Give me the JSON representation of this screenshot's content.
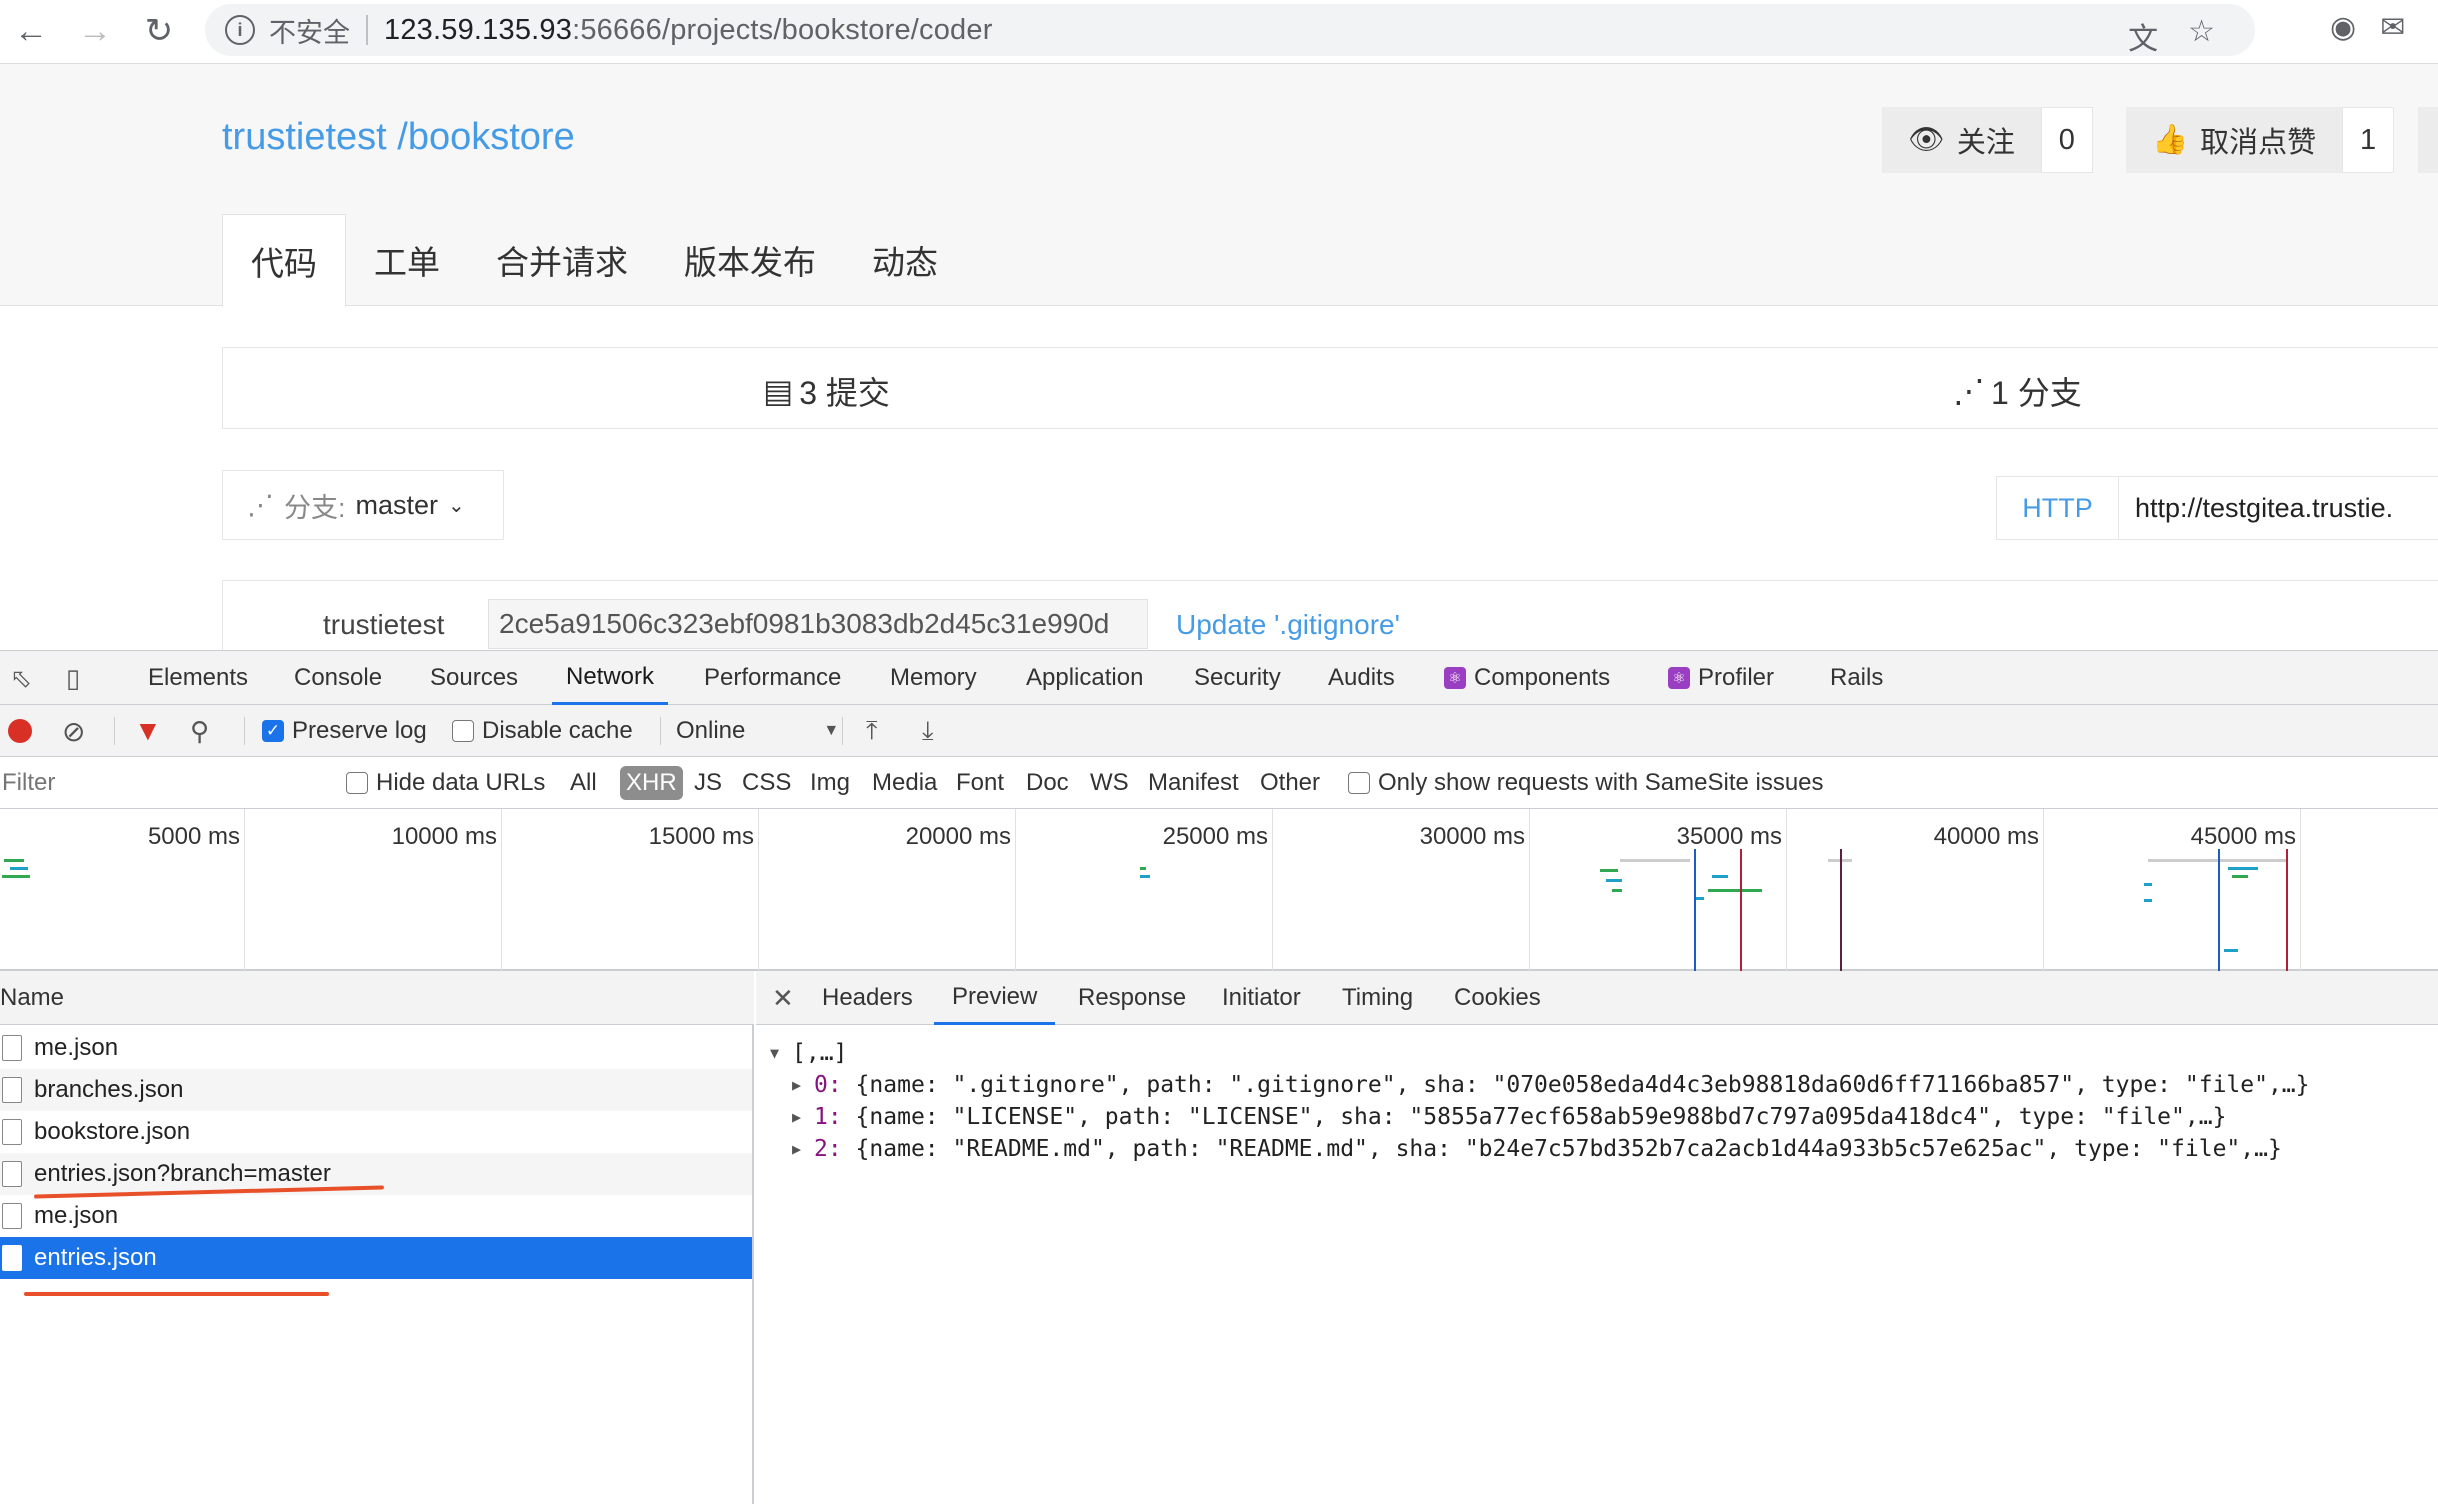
{
  "browser": {
    "insecure_label": "不安全",
    "url_host": "123.59.135.93",
    "url_rest": ":56666/projects/bookstore/coder"
  },
  "repo": {
    "title": "trustietest /bookstore",
    "watch_label": "关注",
    "watch_count": "0",
    "like_label": "取消点赞",
    "like_count": "1",
    "tabs": [
      "代码",
      "工单",
      "合并请求",
      "版本发布",
      "动态"
    ],
    "commits_stat": "3 提交",
    "branches_stat": "1 分支",
    "branch_label": "分支:",
    "branch_value": "master",
    "clone_protocol": "HTTP",
    "clone_url": "http://testgitea.trustie.",
    "commit_author": "trustietest",
    "commit_sha": "2ce5a91506c323ebf0981b3083db2d45c31e990d",
    "commit_message": "Update '.gitignore'"
  },
  "devtools": {
    "tabs": [
      "Elements",
      "Console",
      "Sources",
      "Network",
      "Performance",
      "Memory",
      "Application",
      "Security",
      "Audits",
      "Components",
      "Profiler",
      "Rails"
    ],
    "toolbar": {
      "preserve_log": "Preserve log",
      "disable_cache": "Disable cache",
      "throttle": "Online"
    },
    "filter": {
      "placeholder": "Filter",
      "hide_data_urls": "Hide data URLs",
      "types": [
        "All",
        "XHR",
        "JS",
        "CSS",
        "Img",
        "Media",
        "Font",
        "Doc",
        "WS",
        "Manifest",
        "Other"
      ],
      "samesite": "Only show requests with SameSite issues"
    },
    "timeline_labels": [
      "5000 ms",
      "10000 ms",
      "15000 ms",
      "20000 ms",
      "25000 ms",
      "30000 ms",
      "35000 ms",
      "40000 ms",
      "45000 ms"
    ],
    "requests_header": "Name",
    "requests": [
      "me.json",
      "branches.json",
      "bookstore.json",
      "entries.json?branch=master",
      "me.json",
      "entries.json"
    ],
    "detail_tabs": [
      "Headers",
      "Preview",
      "Response",
      "Initiator",
      "Timing",
      "Cookies"
    ],
    "preview": {
      "root": "[,…]",
      "items": [
        {
          "index": "0:",
          "text": " {name: \".gitignore\", path: \".gitignore\", sha: \"070e058eda4d4c3eb98818da60d6ff71166ba857\", type: \"file\",…}"
        },
        {
          "index": "1:",
          "text": " {name: \"LICENSE\", path: \"LICENSE\", sha: \"5855a77ecf658ab59e988bd7c797a095da418dc4\", type: \"file\",…}"
        },
        {
          "index": "2:",
          "text": " {name: \"README.md\", path: \"README.md\", sha: \"b24e7c57bd352b7ca2acb1d44a933b5c57e625ac\", type: \"file\",…}"
        }
      ]
    }
  },
  "colors": {
    "link_blue": "#459be5",
    "devtools_accent": "#1a73e8",
    "annotation_red": "#e8502a"
  }
}
